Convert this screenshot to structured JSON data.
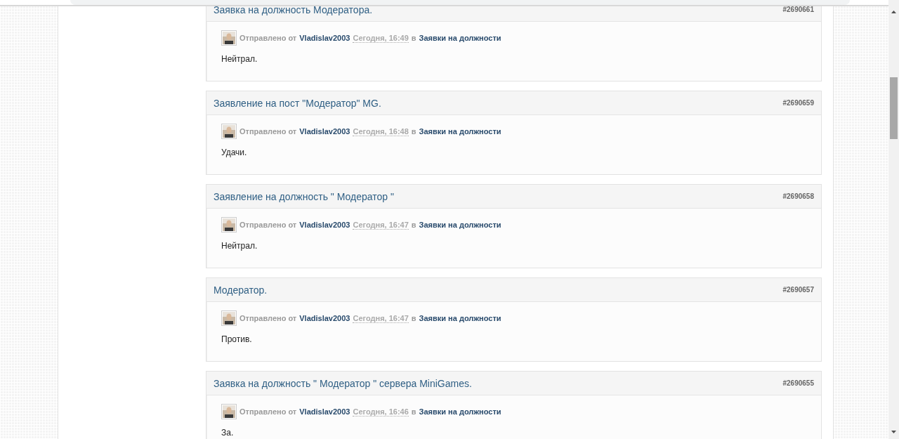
{
  "posts": [
    {
      "title": "Заявка на должность Модератора.",
      "id": "#2690661",
      "sent_by": "Отправлено от",
      "author": "Vladislav2003",
      "date": "Сегодня, 16:49",
      "in": "в",
      "forum": "Заявки на должности",
      "text": "Нейтрал."
    },
    {
      "title": "Заявление на пост \"Модератор\" MG.",
      "id": "#2690659",
      "sent_by": "Отправлено от",
      "author": "Vladislav2003",
      "date": "Сегодня, 16:48",
      "in": "в",
      "forum": "Заявки на должности",
      "text": "Удачи."
    },
    {
      "title": "Заявление на должность \" Модератор \"",
      "id": "#2690658",
      "sent_by": "Отправлено от",
      "author": "Vladislav2003",
      "date": "Сегодня, 16:47",
      "in": "в",
      "forum": "Заявки на должности",
      "text": "Нейтрал."
    },
    {
      "title": "Модератор.",
      "id": "#2690657",
      "sent_by": "Отправлено от",
      "author": "Vladislav2003",
      "date": "Сегодня, 16:47",
      "in": "в",
      "forum": "Заявки на должности",
      "text": "Против."
    },
    {
      "title": "Заявка на должность \" Модератор \" сервера MiniGames.",
      "id": "#2690655",
      "sent_by": "Отправлено от",
      "author": "Vladislav2003",
      "date": "Сегодня, 16:46",
      "in": "в",
      "forum": "Заявки на должности",
      "text": "За."
    }
  ]
}
